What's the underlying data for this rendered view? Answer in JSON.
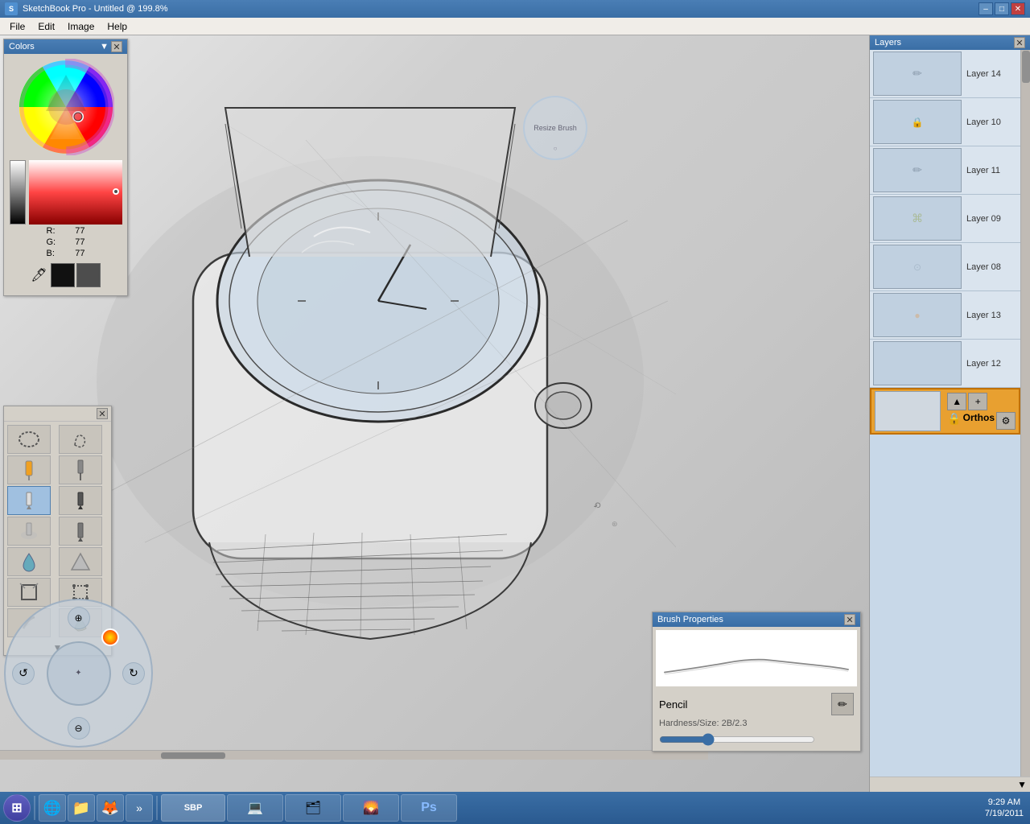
{
  "window": {
    "title": "SketchBook Pro - Untitled @ 199.8%",
    "icon": "sketchbook-icon"
  },
  "menu": {
    "items": [
      "File",
      "Edit",
      "Image",
      "Help"
    ]
  },
  "colors_panel": {
    "title": "Colors",
    "r": "77",
    "g": "77",
    "b": "77"
  },
  "layers_panel": {
    "title": "Layers",
    "layers": [
      {
        "name": "Layer 14",
        "id": "layer-14"
      },
      {
        "name": "Layer 10",
        "id": "layer-10"
      },
      {
        "name": "Layer 11",
        "id": "layer-11"
      },
      {
        "name": "Layer 09",
        "id": "layer-09"
      },
      {
        "name": "Layer 08",
        "id": "layer-08"
      },
      {
        "name": "Layer 13",
        "id": "layer-13"
      },
      {
        "name": "Layer 12",
        "id": "layer-12"
      }
    ],
    "active_layer": "Orthos"
  },
  "brush_properties": {
    "title": "Brush Properties",
    "brush_name": "Pencil",
    "hardness_size": "Hardness/Size: 2B/2.3"
  },
  "resize_brush": {
    "label": "Resize Brush"
  },
  "taskbar": {
    "time": "9:29 AM",
    "date": "7/19/2011"
  }
}
